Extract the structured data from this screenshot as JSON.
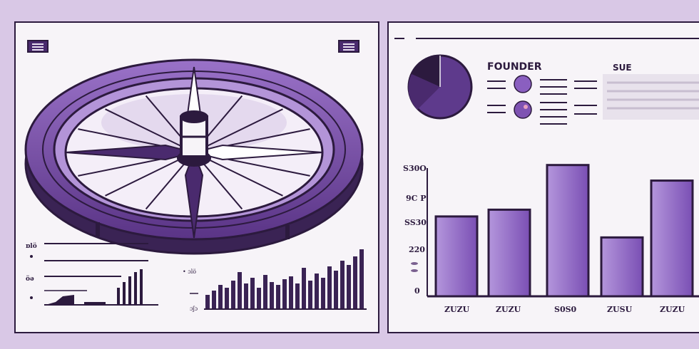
{
  "right_panel": {
    "heading_founder": "FOUNDER",
    "heading_sue": "SUE",
    "y_axis_labels": [
      "S30O",
      "9C P",
      "SS30",
      "220",
      "0"
    ],
    "x_axis_labels": [
      "ZUZU",
      "ZUZU",
      "S0S0",
      "ZUSU",
      "ZUZU"
    ]
  },
  "chart_data": {
    "type": "bar",
    "values": [
      118,
      128,
      194,
      87,
      171
    ],
    "ylim": [
      0,
      200
    ]
  },
  "colors": {
    "background": "#d9c8e6",
    "panel": "#f7f4f8",
    "ink": "#2c1a3e",
    "accent": "#8a5fc0",
    "accent_dark": "#4a2a6e"
  }
}
